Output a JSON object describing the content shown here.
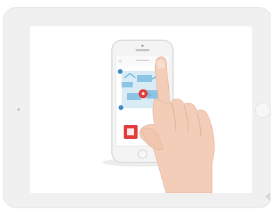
{
  "device": {
    "type": "tablet",
    "orientation": "landscape"
  },
  "screen_content": {
    "subject": "hand-tapping-smartphone-app",
    "phone_ui": {
      "accent_color": "#e23b3b",
      "secondary_color": "#5aa9d6"
    }
  }
}
